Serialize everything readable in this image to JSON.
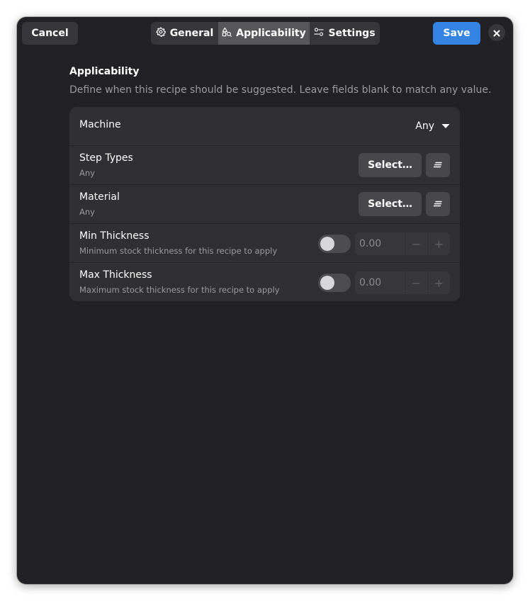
{
  "header": {
    "cancel_label": "Cancel",
    "save_label": "Save",
    "tabs": [
      {
        "label": "General",
        "icon": "gear-icon",
        "active": false
      },
      {
        "label": "Applicability",
        "icon": "shapes-icon",
        "active": true
      },
      {
        "label": "Settings",
        "icon": "sliders-icon",
        "active": false
      }
    ]
  },
  "section": {
    "title": "Applicability",
    "description": "Define when this recipe should be suggested. Leave fields blank to match any value."
  },
  "rows": {
    "machine": {
      "title": "Machine",
      "value": "Any"
    },
    "step_types": {
      "title": "Step Types",
      "subtitle": "Any",
      "button": "Select…"
    },
    "material": {
      "title": "Material",
      "subtitle": "Any",
      "button": "Select…"
    },
    "min_thickness": {
      "title": "Min Thickness",
      "subtitle": "Minimum stock thickness for this recipe to apply",
      "value": "0.00",
      "enabled": false
    },
    "max_thickness": {
      "title": "Max Thickness",
      "subtitle": "Maximum stock thickness for this recipe to apply",
      "value": "0.00",
      "enabled": false
    }
  },
  "colors": {
    "window_bg": "#222226",
    "card_bg": "#303034",
    "accent": "#3584e4"
  }
}
